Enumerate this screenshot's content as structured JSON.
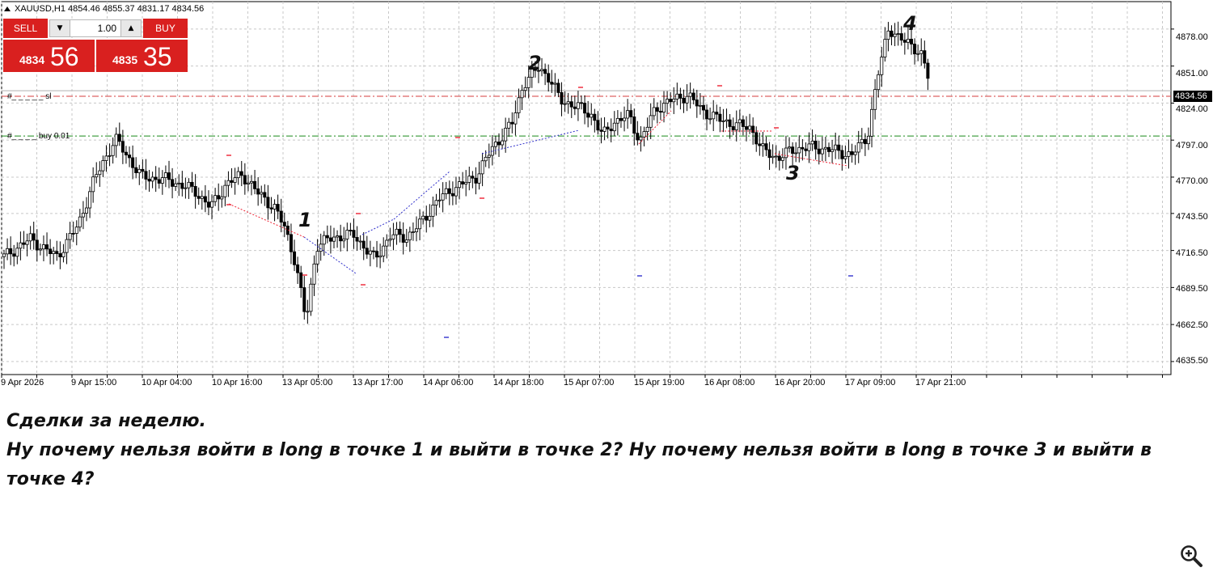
{
  "chart": {
    "symbol": "XAUUSD,H1",
    "ohlc": "4854.46 4855.37 4831.17 4834.56",
    "current_price": "4834.56",
    "y_ticks": [
      "4878.00",
      "4851.00",
      "4824.00",
      "4797.00",
      "4770.00",
      "4743.50",
      "4716.50",
      "4689.50",
      "4662.50",
      "4635.50"
    ],
    "x_ticks": [
      "9 Apr 2026",
      "9 Apr 15:00",
      "10 Apr 04:00",
      "10 Apr 16:00",
      "13 Apr 05:00",
      "13 Apr 17:00",
      "14 Apr 06:00",
      "14 Apr 18:00",
      "15 Apr 07:00",
      "15 Apr 19:00",
      "16 Apr 08:00",
      "16 Apr 20:00",
      "17 Apr 09:00",
      "17 Apr 21:00"
    ],
    "order_lines": [
      {
        "label": "#_ _ _ _ _ sl",
        "color": "#d43c3c"
      },
      {
        "label": "#_ _ _ _ buy 0.01",
        "color": "#1a8a1a"
      }
    ],
    "wave_labels": [
      "1",
      "2",
      "3",
      "4"
    ]
  },
  "trade_panel": {
    "sell_label": "SELL",
    "buy_label": "BUY",
    "lot": "1.00",
    "sell_small": "4834",
    "sell_big": "56",
    "buy_small": "4835",
    "buy_big": "35"
  },
  "caption": {
    "line1": "Сделки за неделю.",
    "line2": " Ну почему нельзя войти в long в точке 1 и выйти в точке 2? Ну почему нельзя войти в long в точке 3 и выйти в точке 4?"
  },
  "icons": {
    "zoom": "zoom-in-icon",
    "symbol_arrow": "triangle-up-icon"
  },
  "colors": {
    "panel_red": "#d9201f",
    "sl_line": "#d43c3c",
    "buy_line": "#1a8a1a"
  },
  "chart_data": {
    "type": "candlestick",
    "symbol": "XAUUSD",
    "timeframe": "H1",
    "ylim": [
      4626,
      4898
    ],
    "xlabel": "",
    "ylabel": "",
    "annotated_points": [
      {
        "label": "1",
        "x": "13 Apr 10:00",
        "y": 4728
      },
      {
        "label": "2",
        "x": "14 Apr 22:00",
        "y": 4872
      },
      {
        "label": "3",
        "x": "16 Apr 22:00",
        "y": 4780
      },
      {
        "label": "4",
        "x": "17 Apr 14:00",
        "y": 4895
      }
    ],
    "horizontal_levels": [
      {
        "name": "sl",
        "y": 4829
      },
      {
        "name": "buy 0.01",
        "y": 4800
      }
    ]
  }
}
